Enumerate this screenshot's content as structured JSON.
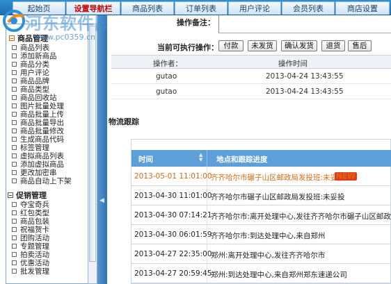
{
  "top_nav": {
    "tabs": [
      {
        "label": "起始页"
      },
      {
        "label": "设置导航栏"
      },
      {
        "label": "商品列表"
      },
      {
        "label": "订单列表"
      },
      {
        "label": "用户评论"
      },
      {
        "label": "会员列表"
      },
      {
        "label": "商店设置"
      }
    ]
  },
  "watermark": {
    "title": "河东软件园",
    "url": "www.pc0359.cn"
  },
  "sidebar": {
    "group_product": "商品管理",
    "product_items": [
      "商品列表",
      "添加新商品",
      "商品分类",
      "用户评论",
      "商品品牌",
      "商品类型",
      "商品回收站",
      "图片批量处理",
      "商品批量上传",
      "商品批量导出",
      "商品批量修改",
      "生成商品代码",
      "标签管理",
      "虚拟商品列表",
      "添加虚拟商品",
      "更改加密串",
      "商品自动上下架"
    ],
    "group_promo": "促销管理",
    "promo_items": [
      "夺宝奇兵",
      "红包类型",
      "商品包装",
      "祝福贺卡",
      "团购活动",
      "专题管理",
      "拍卖活动",
      "优惠活动",
      "批发管理"
    ]
  },
  "order": {
    "remark_label": "操作备注：",
    "ops_label": "当前可执行操作：",
    "op_buttons": [
      "付款",
      "未发货",
      "确认发货",
      "退货",
      "售后"
    ],
    "log_headers": {
      "operator": "操作者：",
      "time": "操作时间"
    },
    "log_rows": [
      {
        "operator": "gutao",
        "time": "2013-04-24 13:43:55"
      },
      {
        "operator": "gutao",
        "time": "2013-04-24 13:43:55"
      }
    ]
  },
  "tracking": {
    "title": "物流跟踪",
    "headers": {
      "time": "时间",
      "progress": "地点和跟踪进度"
    },
    "new_badge": "NEW",
    "rows": [
      {
        "time": "2013-05-01 11:01:00",
        "progress": "齐齐哈尔市碾子山区邮政局发投班:未妥投"
      },
      {
        "time": "2013-04-30 11:01:00",
        "progress": "齐齐哈尔市碾子山区邮政局发投班:未妥投"
      },
      {
        "time": "2013-04-30 07:14:21",
        "progress": "齐齐哈尔市:离开处理中心,发往齐齐哈尔市碾子山区邮政局发"
      },
      {
        "time": "2013-04-30 06:01:59",
        "progress": "齐齐哈尔市:到达处理中心,来自郑州"
      },
      {
        "time": "2013-04-27 22:35:00",
        "progress": "郑州:离开处理中心,发往齐齐哈尔市"
      },
      {
        "time": "2013-04-27 20:59:45",
        "progress": "郑州:到达处理中心,来自郑州郑东速递公司"
      }
    ]
  },
  "colors": {
    "accent": "#2f8fd0",
    "header_blue": "#5d9fd8",
    "latest_row": "#d96a10"
  }
}
